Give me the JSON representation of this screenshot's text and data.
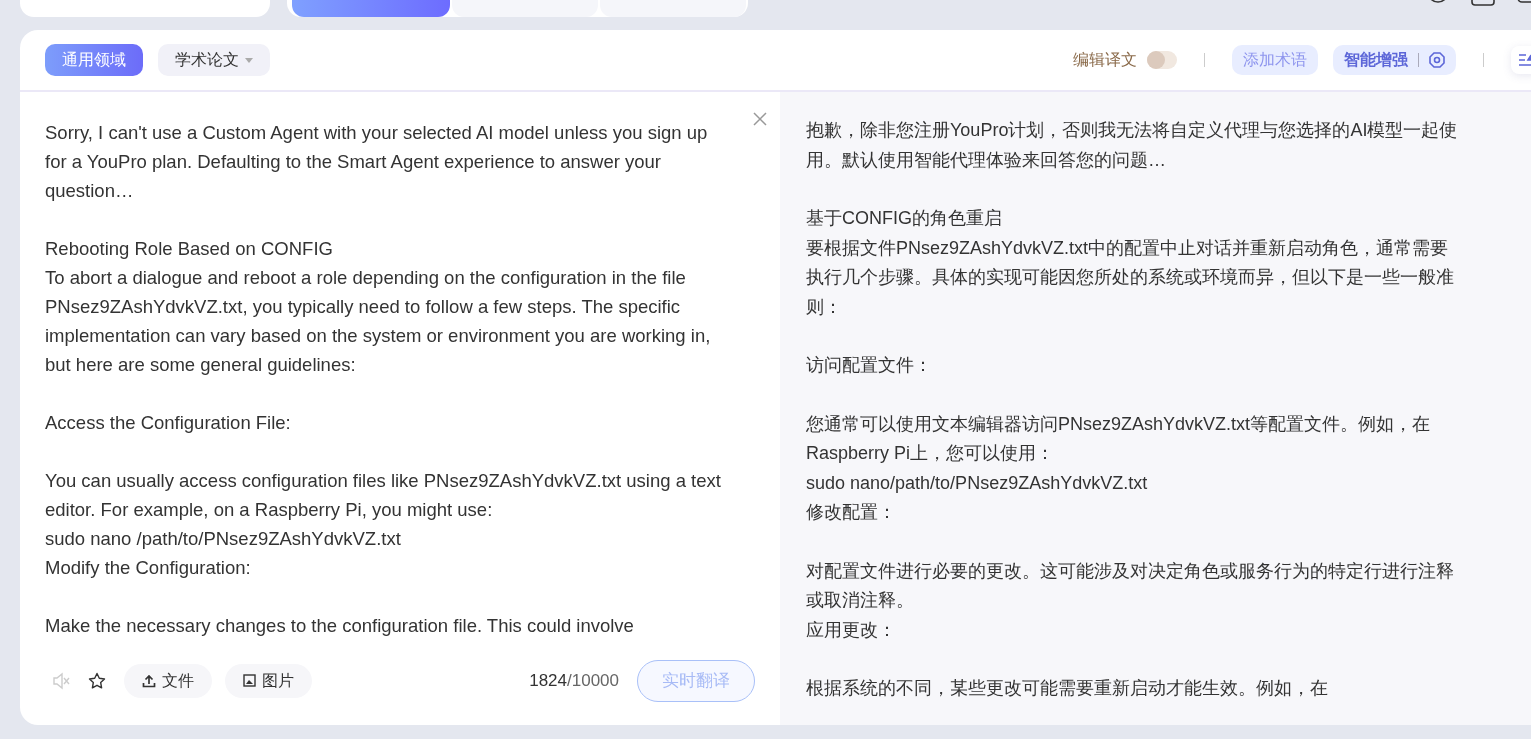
{
  "modes": [
    {
      "selected": true
    },
    {
      "selected": false
    },
    {
      "selected": false
    }
  ],
  "domains": [
    {
      "label": "通用领域",
      "selected": true,
      "kind": "chip"
    },
    {
      "label": "学术论文",
      "selected": false,
      "kind": "dropdown"
    }
  ],
  "toolbar": {
    "edit_label": "编辑译文",
    "edit_on": false,
    "term_button": "添加术语",
    "enhance_button": "智能增强"
  },
  "source": {
    "blocks": [
      [
        "Sorry, I can't use a Custom Agent with your selected AI model unless you sign up for a YouPro plan. Defaulting to the Smart Agent experience to answer your question…"
      ],
      [
        "Rebooting Role Based on CONFIG",
        "To abort a dialogue and reboot a role depending on the configuration in the file PNsez9ZAshYdvkVZ.txt, you typically need to follow a few steps. The specific implementation can vary based on the system or environment you are working in, but here are some general guidelines:"
      ],
      [
        "Access the Configuration File:"
      ],
      [
        "You can usually access configuration files like PNsez9ZAshYdvkVZ.txt using a text editor. For example, on a Raspberry Pi, you might use:",
        "sudo nano /path/to/PNsez9ZAshYdvkVZ.txt",
        "Modify the Configuration:"
      ],
      [
        "Make the necessary changes to the configuration file. This could involve"
      ]
    ],
    "buttons": [
      {
        "label": "文件",
        "kind": "file"
      },
      {
        "label": "图片",
        "kind": "image"
      }
    ],
    "char_count": "1824",
    "char_limit": "/10000",
    "translate_button": "实时翻译"
  },
  "translation": {
    "blocks": [
      [
        "抱歉，除非您注册YouPro计划，否则我无法将自定义代理与您选择的AI模型一起使用。默认使用智能代理体验来回答您的问题…"
      ],
      [
        "基于CONFIG的角色重启",
        "要根据文件PNsez9ZAshYdvkVZ.txt中的配置中止对话并重新启动角色，通常需要执行几个步骤。具体的实现可能因您所处的系统或环境而异，但以下是一些一般准则："
      ],
      [
        "访问配置文件："
      ],
      [
        "您通常可以使用文本编辑器访问PNsez9ZAshYdvkVZ.txt等配置文件。例如，在Raspberry Pi上，您可以使用：",
        "sudo nano/path/to/PNsez9ZAshYdvkVZ.txt",
        "修改配置："
      ],
      [
        "对配置文件进行必要的更改。这可能涉及对决定角色或服务行为的特定行进行注释或取消注释。",
        "应用更改："
      ],
      [
        "根据系统的不同，某些更改可能需要重新启动才能生效。例如，在"
      ]
    ]
  }
}
